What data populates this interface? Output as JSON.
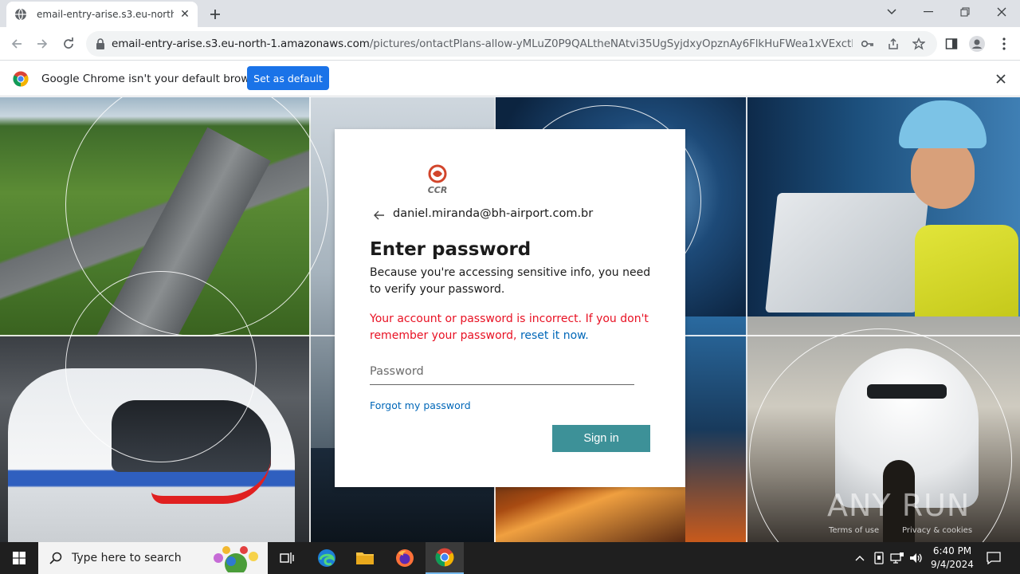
{
  "browser": {
    "tab_title": "email-entry-arise.s3.eu-north-1.amazonaws.com",
    "url_host": "email-entry-arise.s3.eu-north-1.amazonaws.com",
    "url_path": "/pictures/ontactPlans-allow-yMLuZ0P9QALtheNAtvi35UgSyjdxyOpznAy6FlkHuFWea1xVExctKENx8fT..."
  },
  "infobar": {
    "message": "Google Chrome isn't your default browser",
    "button_label": "Set as default"
  },
  "login": {
    "logo_text": "CCR",
    "identity": "daniel.miranda@bh-airport.com.br",
    "title": "Enter password",
    "description": "Because you're accessing sensitive info, you need to verify your password.",
    "error_text": "Your account or password is incorrect. If you don't remember your password, ",
    "error_link": "reset it now.",
    "password_placeholder": "Password",
    "forgot_label": "Forgot my password",
    "signin_label": "Sign in"
  },
  "watermark": {
    "brand": "ANY RUN",
    "terms": "Terms of use",
    "privacy": "Privacy & cookies"
  },
  "taskbar": {
    "search_placeholder": "Type here to search",
    "time": "6:40 PM",
    "date": "9/4/2024"
  }
}
